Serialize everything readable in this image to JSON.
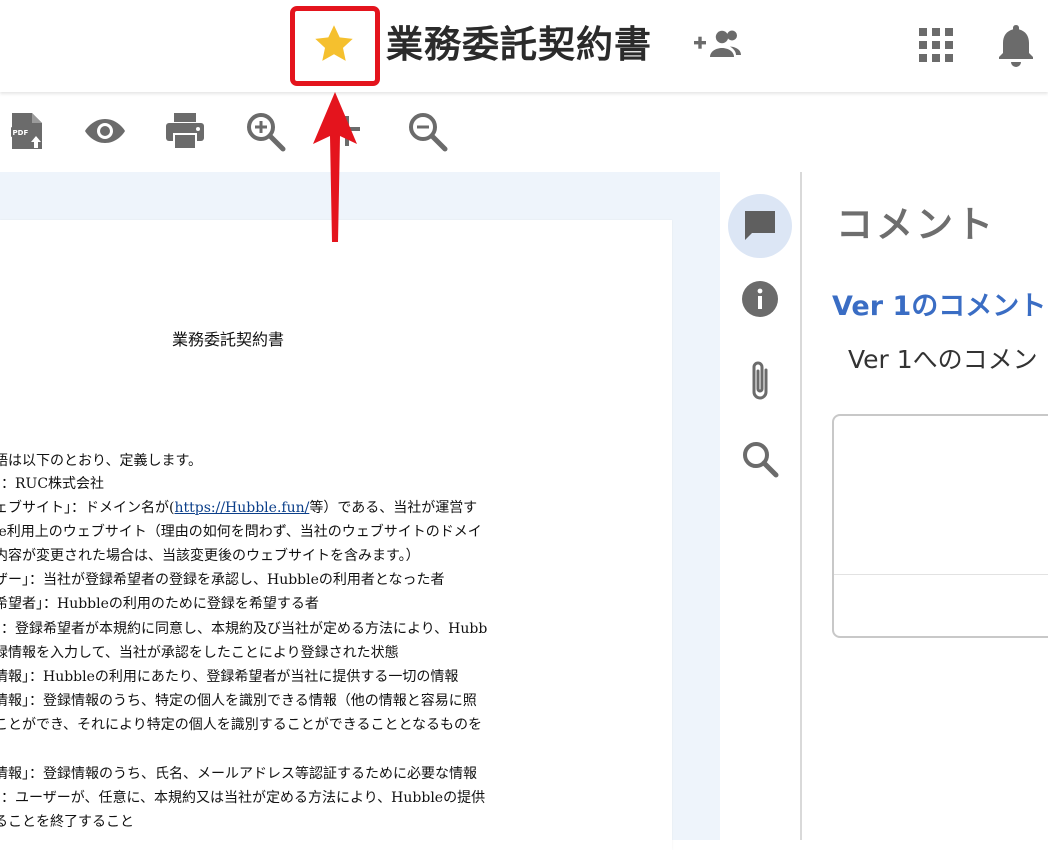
{
  "header": {
    "document_title": "業務委託契約書",
    "icons": {
      "star": "star-icon",
      "share": "add-people-icon",
      "apps": "apps-grid-icon",
      "notifications": "bell-icon"
    },
    "colors": {
      "star": "#f5c02e",
      "highlight": "#e4141d"
    }
  },
  "toolbar": {
    "icons": [
      "pdf-export-icon",
      "eye-icon",
      "print-icon",
      "zoom-in-icon",
      "fit-icon",
      "zoom-out-icon"
    ]
  },
  "document": {
    "heading": "業務委託契約書",
    "lines": [
      ")",
      ")",
      "語は以下のとおり、定義します。",
      "」：RUC株式会社",
      "ェブサイト」：ドメイン名が(",
      "le利用上のウェブサイト（理由の如何を問わず、当社のウェブサイトのドメイ",
      "内容が変更された場合は、当該変更後のウェブサイトを含みます。）",
      "ザー」：当社が登録希望者の登録を承認し、Hubbleの利用者となった者",
      "希望者」：Hubbleの利用のために登録を希望する者",
      "」：登録希望者が本規約に同意し、本規約及び当社が定める方法により、Hubb",
      "録情報を入力して、当社が承認をしたことにより登録された状態",
      "情報」：Hubbleの利用にあたり、登録希望者が当社に提供する一切の情報",
      "情報」：登録情報のうち、特定の個人を識別できる情報（他の情報と容易に照",
      "ことができ、それにより特定の個人を識別することができることとなるものを",
      "情報」：登録情報のうち、氏名、メールアドレス等認証するために必要な情報",
      "」：ユーザーが、任意に、本規約又は当社が定める方法により、Hubbleの提供",
      "ることを終了すること"
    ],
    "link_text": "https://Hubble.fun/",
    "link_suffix": "等）である、当社が運営す"
  },
  "side_rail": {
    "icons": [
      "comment-icon",
      "info-icon",
      "attachment-icon",
      "search-icon"
    ],
    "active": "comment-icon"
  },
  "comments_panel": {
    "title": "コメント",
    "version_heading": "Ver 1のコメント",
    "version_sub": "Ver 1へのコメン",
    "accent_color": "#3a6dc4"
  }
}
